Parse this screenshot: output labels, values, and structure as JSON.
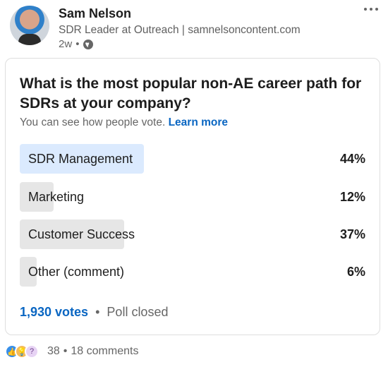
{
  "author": {
    "name": "Sam Nelson",
    "headline": "SDR Leader at Outreach | samnelsoncontent.com",
    "time": "2w",
    "separator": "•"
  },
  "poll": {
    "question": "What is the most popular non-AE career path for SDRs at your company?",
    "visibility_text": "You can see how people vote.",
    "learn_more": "Learn more",
    "options": [
      {
        "label": "SDR Management",
        "percent": "44%",
        "fill": 0.44,
        "leading": true
      },
      {
        "label": "Marketing",
        "percent": "12%",
        "fill": 0.12,
        "leading": false
      },
      {
        "label": "Customer Success",
        "percent": "37%",
        "fill": 0.37,
        "leading": false
      },
      {
        "label": "Other (comment)",
        "percent": "6%",
        "fill": 0.06,
        "leading": false
      }
    ],
    "votes": "1,930 votes",
    "separator": "•",
    "status": "Poll closed"
  },
  "social": {
    "reaction_count": "38",
    "separator": "•",
    "comments": "18 comments",
    "reactions": [
      "like-icon",
      "insightful-icon",
      "curious-icon"
    ]
  },
  "colors": {
    "accent": "#0a66c2",
    "leading_bar": "#dbeafe",
    "other_bar": "#e6e6e6"
  }
}
